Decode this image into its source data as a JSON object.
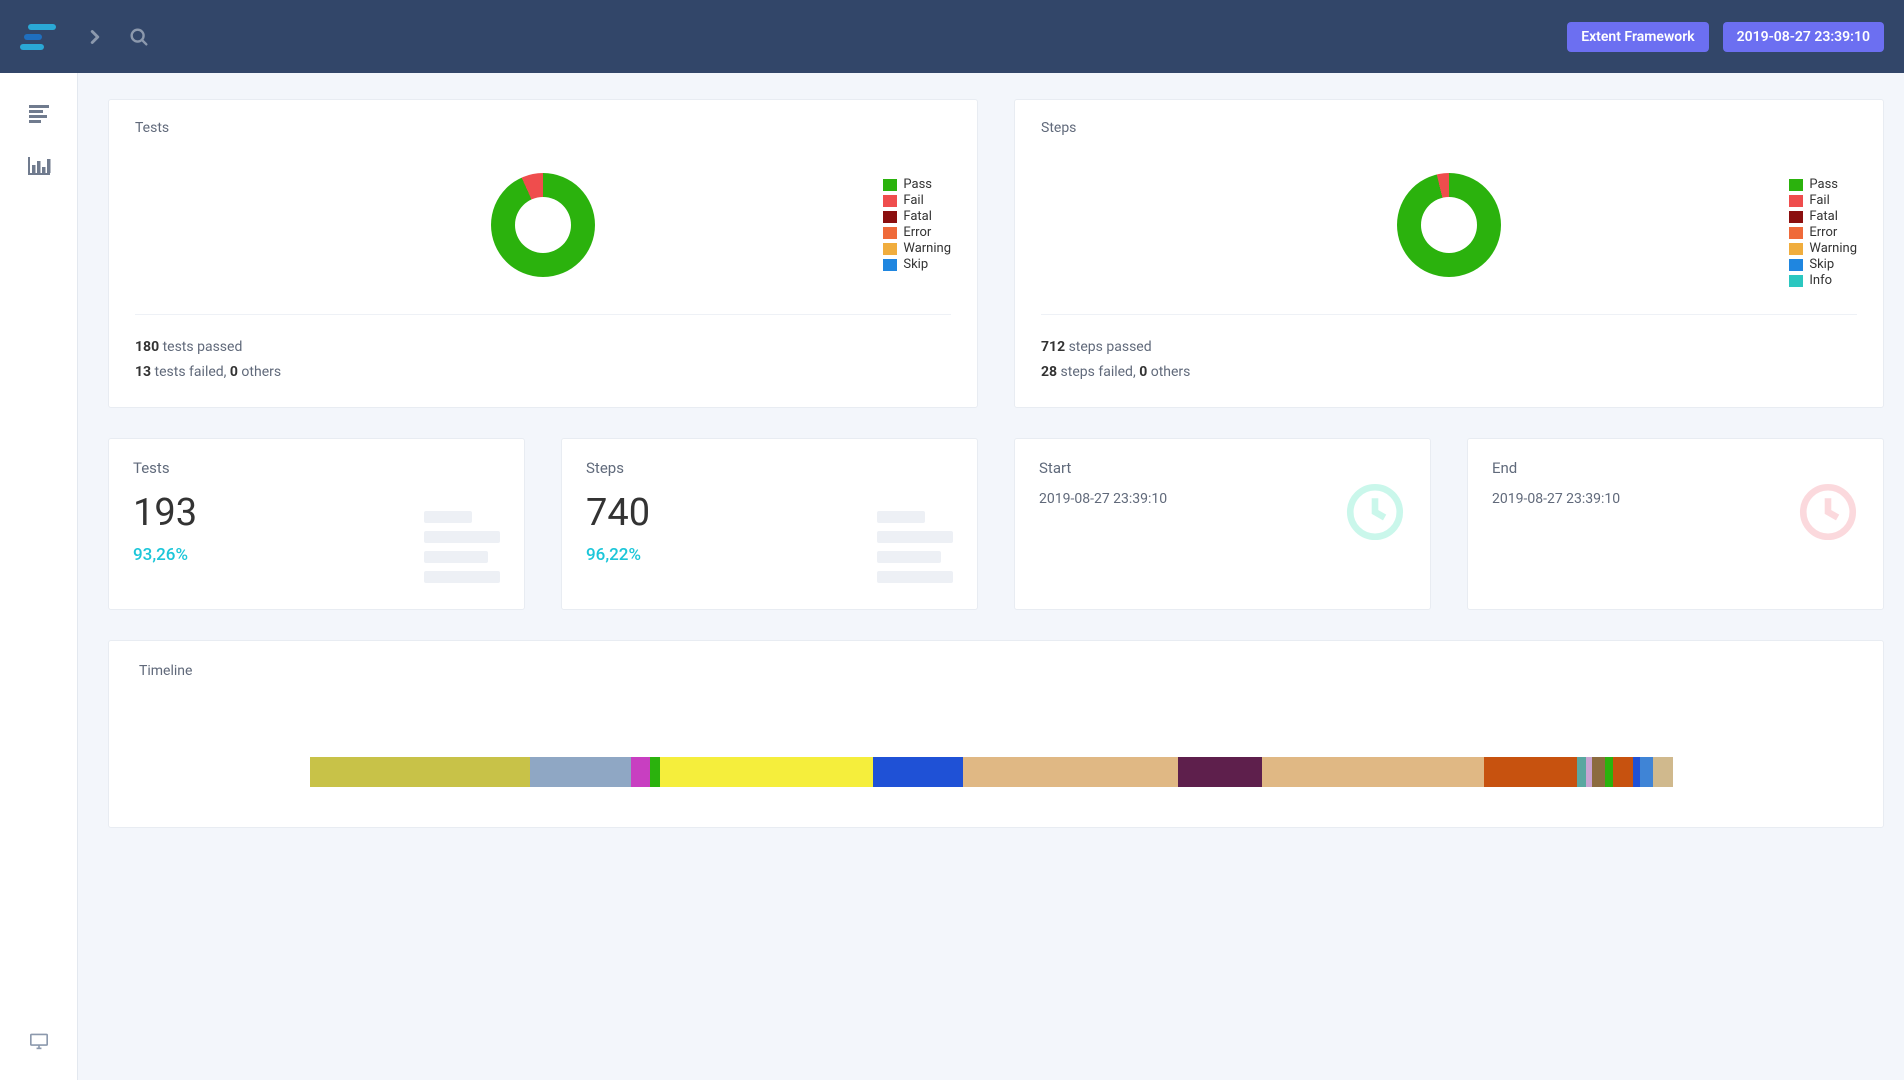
{
  "header": {
    "framework_label": "Extent Framework",
    "timestamp": "2019-08-27 23:39:10"
  },
  "tests_card": {
    "title": "Tests",
    "passed_count": "180",
    "passed_text": " tests passed",
    "failed_count": "13",
    "failed_text": " tests failed, ",
    "others_count": "0",
    "others_text": " others",
    "legend": [
      {
        "label": "Pass",
        "color": "#2bb20d"
      },
      {
        "label": "Fail",
        "color": "#ef4d4d"
      },
      {
        "label": "Fatal",
        "color": "#8b0f0f"
      },
      {
        "label": "Error",
        "color": "#ef6a3a"
      },
      {
        "label": "Warning",
        "color": "#f0ad3e"
      },
      {
        "label": "Skip",
        "color": "#1f86e0"
      }
    ]
  },
  "steps_card": {
    "title": "Steps",
    "passed_count": "712",
    "passed_text": " steps passed",
    "failed_count": "28",
    "failed_text": " steps failed, ",
    "others_count": "0",
    "others_text": " others",
    "legend": [
      {
        "label": "Pass",
        "color": "#2bb20d"
      },
      {
        "label": "Fail",
        "color": "#ef4d4d"
      },
      {
        "label": "Fatal",
        "color": "#8b0f0f"
      },
      {
        "label": "Error",
        "color": "#ef6a3a"
      },
      {
        "label": "Warning",
        "color": "#f0ad3e"
      },
      {
        "label": "Skip",
        "color": "#1f86e0"
      },
      {
        "label": "Info",
        "color": "#2bc7c0"
      }
    ]
  },
  "stats": {
    "tests": {
      "title": "Tests",
      "count": "193",
      "pct": "93,26%"
    },
    "steps": {
      "title": "Steps",
      "count": "740",
      "pct": "96,22%"
    },
    "start": {
      "title": "Start",
      "time": "2019-08-27 23:39:10"
    },
    "end": {
      "title": "End",
      "time": "2019-08-27 23:39:10"
    }
  },
  "timeline": {
    "title": "Timeline",
    "segments": [
      {
        "color": "#c8c248",
        "w": 16.0
      },
      {
        "color": "#8fa7c4",
        "w": 7.4
      },
      {
        "color": "#c83fc1",
        "w": 1.4
      },
      {
        "color": "#2bb20d",
        "w": 0.7
      },
      {
        "color": "#f5ee3c",
        "w": 15.5
      },
      {
        "color": "#1f51d6",
        "w": 6.6
      },
      {
        "color": "#e0b884",
        "w": 15.7
      },
      {
        "color": "#5e1f4c",
        "w": 6.1
      },
      {
        "color": "#e0b884",
        "w": 16.2
      },
      {
        "color": "#c7520f",
        "w": 6.8
      },
      {
        "color": "#5aa7a0",
        "w": 0.6
      },
      {
        "color": "#caa4d2",
        "w": 0.5
      },
      {
        "color": "#8c6b3f",
        "w": 0.9
      },
      {
        "color": "#2bb20d",
        "w": 0.6
      },
      {
        "color": "#c7520f",
        "w": 1.5
      },
      {
        "color": "#1f51d6",
        "w": 0.5
      },
      {
        "color": "#3f84d6",
        "w": 0.9
      },
      {
        "color": "#d0b98d",
        "w": 1.5
      }
    ]
  },
  "chart_data": [
    {
      "type": "pie",
      "title": "Tests",
      "series": [
        {
          "name": "Pass",
          "value": 180,
          "color": "#2bb20d"
        },
        {
          "name": "Fail",
          "value": 13,
          "color": "#ef4d4d"
        },
        {
          "name": "Fatal",
          "value": 0,
          "color": "#8b0f0f"
        },
        {
          "name": "Error",
          "value": 0,
          "color": "#ef6a3a"
        },
        {
          "name": "Warning",
          "value": 0,
          "color": "#f0ad3e"
        },
        {
          "name": "Skip",
          "value": 0,
          "color": "#1f86e0"
        }
      ],
      "total": 193
    },
    {
      "type": "pie",
      "title": "Steps",
      "series": [
        {
          "name": "Pass",
          "value": 712,
          "color": "#2bb20d"
        },
        {
          "name": "Fail",
          "value": 28,
          "color": "#ef4d4d"
        },
        {
          "name": "Fatal",
          "value": 0,
          "color": "#8b0f0f"
        },
        {
          "name": "Error",
          "value": 0,
          "color": "#ef6a3a"
        },
        {
          "name": "Warning",
          "value": 0,
          "color": "#f0ad3e"
        },
        {
          "name": "Skip",
          "value": 0,
          "color": "#1f86e0"
        },
        {
          "name": "Info",
          "value": 0,
          "color": "#2bc7c0"
        }
      ],
      "total": 740
    }
  ]
}
